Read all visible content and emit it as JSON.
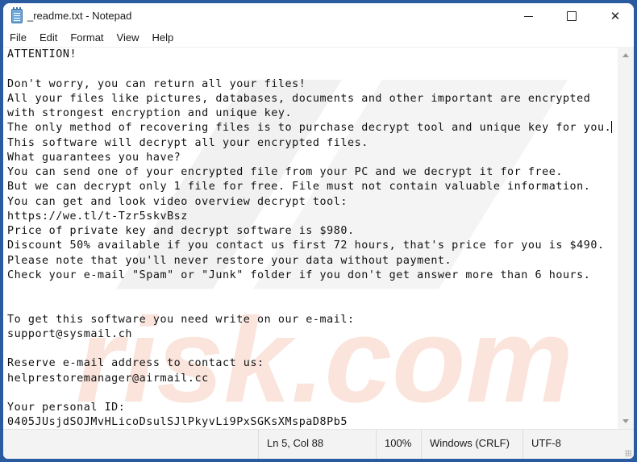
{
  "window": {
    "title": "_readme.txt - Notepad",
    "icon": "notepad-icon",
    "controls": {
      "minimize": "minimize-icon",
      "maximize": "maximize-icon",
      "close": "close-icon",
      "close_glyph": "✕"
    }
  },
  "menu": [
    "File",
    "Edit",
    "Format",
    "View",
    "Help"
  ],
  "document": {
    "lines": [
      "ATTENTION!",
      "",
      "Don't worry, you can return all your files!",
      "All your files like pictures, databases, documents and other important are encrypted",
      "with strongest encryption and unique key.",
      "The only method of recovering files is to purchase decrypt tool and unique key for you.",
      "This software will decrypt all your encrypted files.",
      "What guarantees you have?",
      "You can send one of your encrypted file from your PC and we decrypt it for free.",
      "But we can decrypt only 1 file for free. File must not contain valuable information.",
      "You can get and look video overview decrypt tool:",
      "https://we.tl/t-Tzr5skvBsz",
      "Price of private key and decrypt software is $980.",
      "Discount 50% available if you contact us first 72 hours, that's price for you is $490.",
      "Please note that you'll never restore your data without payment.",
      "Check your e-mail \"Spam\" or \"Junk\" folder if you don't get answer more than 6 hours.",
      "",
      "",
      "To get this software you need write on our e-mail:",
      "support@sysmail.ch",
      "",
      "Reserve e-mail address to contact us:",
      "helprestoremanager@airmail.cc",
      "",
      "Your personal ID:",
      "0405JUsjdSOJMvHLicoDsulSJlPkyvLi9PxSGKsXMspaD8Pb5"
    ],
    "caret_line_index": 5
  },
  "watermark": {
    "text": "risk.com",
    "color": "#e8704a"
  },
  "statusbar": {
    "position": "Ln 5, Col 88",
    "zoom": "100%",
    "line_ending": "Windows (CRLF)",
    "encoding": "UTF-8"
  },
  "colors": {
    "desktop": "#2a5aa0",
    "window": "#ffffff",
    "statusbar": "#f3f3f3"
  }
}
